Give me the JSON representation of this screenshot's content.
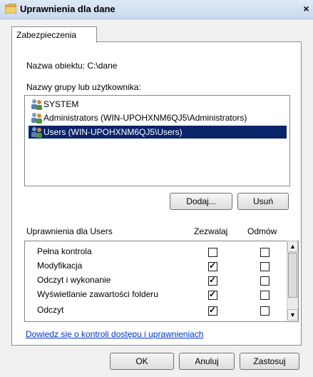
{
  "window": {
    "title": "Uprawnienia dla dane",
    "close_glyph": "×"
  },
  "tab": {
    "label": "Zabezpieczenia"
  },
  "object": {
    "label": "Nazwa obiektu:",
    "value": "C:\\dane"
  },
  "groups": {
    "label": "Nazwy grupy lub użytkownika:",
    "items": [
      {
        "label": "SYSTEM",
        "selected": false,
        "icon": "users-group-icon"
      },
      {
        "label": "Administrators (WIN-UPOHXNM6QJ5\\Administrators)",
        "selected": false,
        "icon": "users-group-icon"
      },
      {
        "label": "Users (WIN-UPOHXNM6QJ5\\Users)",
        "selected": true,
        "icon": "users-group-icon"
      }
    ]
  },
  "buttons": {
    "add": "Dodaj...",
    "remove": "Usuń",
    "ok": "OK",
    "cancel": "Anuluj",
    "apply": "Zastosuj"
  },
  "permissions": {
    "label": "Uprawnienia dla Users",
    "col_allow": "Zezwalaj",
    "col_deny": "Odmów",
    "rows": [
      {
        "name": "Pełna kontrola",
        "allow": false,
        "deny": false
      },
      {
        "name": "Modyfikacja",
        "allow": true,
        "deny": false
      },
      {
        "name": "Odczyt i wykonanie",
        "allow": true,
        "deny": false
      },
      {
        "name": "Wyświetlanie zawartości folderu",
        "allow": true,
        "deny": false
      },
      {
        "name": "Odczyt",
        "allow": true,
        "deny": false
      }
    ]
  },
  "help_link": "Dowiedz się o kontroli dostępu i uprawnieniach",
  "colors": {
    "selection": "#0a246a",
    "link": "#0033cc",
    "titlebar": "#c9d9ee"
  }
}
